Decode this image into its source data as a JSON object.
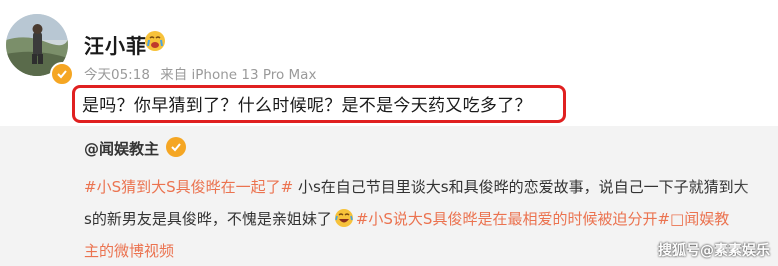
{
  "post": {
    "username": "汪小菲",
    "time": "今天05:18",
    "source": "来自 iPhone 13 Pro Max",
    "text": "是吗？你早猜到了？什么时候呢？是不是今天药又吃多了？"
  },
  "repost": {
    "username": "@闻娱教主",
    "line1_tag": "#小S猜到大S具俊晔在一起了#",
    "line1_text": " 小s在自己节目里谈大s和具俊晔的恋爱故事，说自己一下子就猜到大",
    "line2_text_a": "s的新男友是具俊晔，不愧是亲姐妹了",
    "line2_tag": "#小S说大S具俊晔是在最相爱的时候被迫分开#",
    "line2_link": "□闻娱教",
    "line3_link": "主的微博视频"
  },
  "watermark": "搜狐号@素素娱乐",
  "colors": {
    "tag": "#eb7350",
    "highlight_border": "#e02020",
    "badge": "#f5a623",
    "repost_bg": "#f3f3f3"
  },
  "icons": [
    "avatar-photo",
    "verified-badge-icon",
    "crying-emoji-icon",
    "laughing-emoji-icon"
  ]
}
